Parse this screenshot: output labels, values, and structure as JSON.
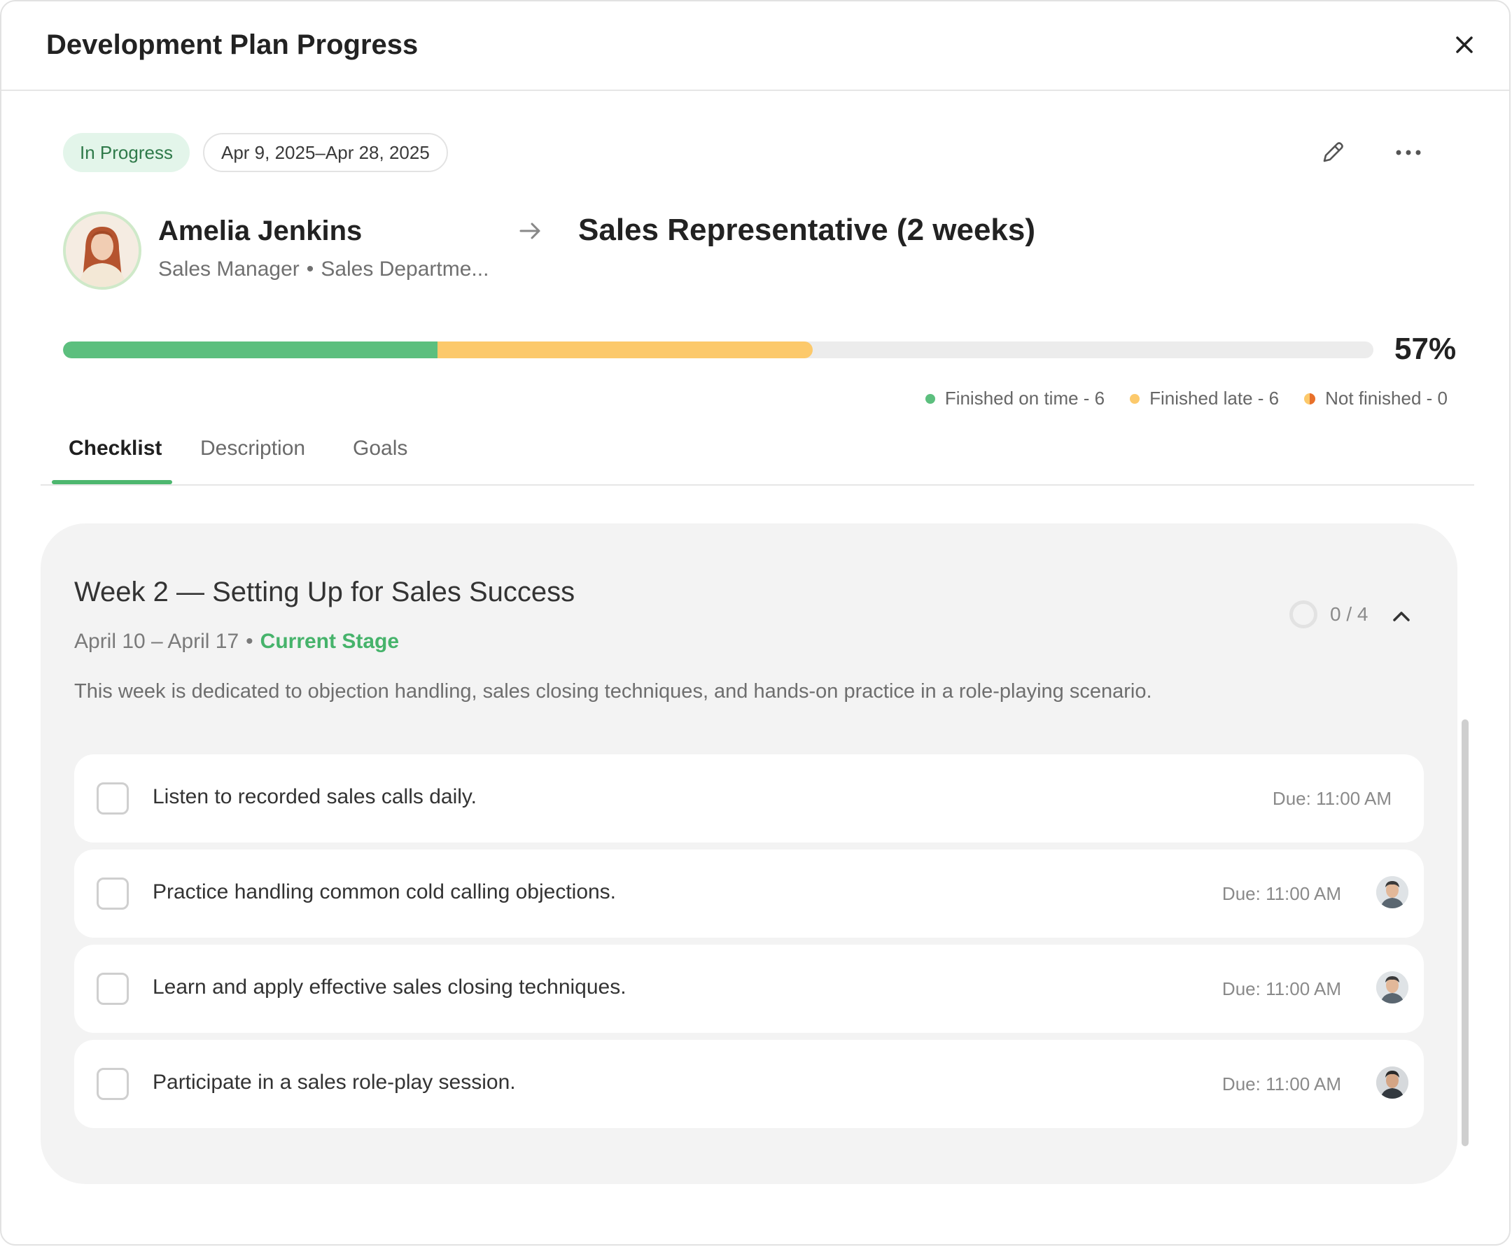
{
  "modal": {
    "title": "Development Plan Progress"
  },
  "plan": {
    "status": "In Progress",
    "date_range": "Apr 9, 2025–Apr 28, 2025",
    "person": {
      "name": "Amelia Jenkins",
      "position": "Sales Manager",
      "department": "Sales Departme..."
    },
    "target_role": "Sales Representative (2 weeks)",
    "progress": {
      "percent_label": "57%",
      "on_time_fraction": 0.286,
      "late_fraction": 0.286,
      "legend": [
        {
          "label": "Finished on time - 6",
          "color": "#5cbf7e"
        },
        {
          "label": "Finished late - 6",
          "color": "#fcc96b"
        },
        {
          "label": "Not finished - 0",
          "color": "#e8702a"
        }
      ]
    }
  },
  "tabs": [
    {
      "label": "Checklist",
      "active": true
    },
    {
      "label": "Description",
      "active": false
    },
    {
      "label": "Goals",
      "active": false
    }
  ],
  "stage": {
    "title": "Week 2 — Setting Up for Sales Success",
    "dates": "April 10 – April 17",
    "current_label": "Current Stage",
    "description": "This week is dedicated to objection handling, sales closing techniques, and hands-on practice in a role-playing scenario.",
    "counter": "0 / 4",
    "tasks": [
      {
        "label": "Listen to recorded sales calls daily.",
        "due": "Due: 11:00 AM",
        "has_assignee": false
      },
      {
        "label": "Practice handling common cold calling objections.",
        "due": "Due: 11:00 AM",
        "has_assignee": true
      },
      {
        "label": "Learn and apply effective sales closing techniques.",
        "due": "Due: 11:00 AM",
        "has_assignee": true
      },
      {
        "label": "Participate in a sales role-play session.",
        "due": "Due: 11:00 AM",
        "has_assignee": true
      }
    ]
  },
  "icons": {
    "close": "close-icon",
    "edit": "pencil-icon",
    "more": "more-horizontal-icon",
    "arrow": "arrow-right-icon",
    "collapse": "chevron-up-icon"
  },
  "colors": {
    "accent_green": "#4db76f",
    "on_time": "#5cbf7e",
    "late": "#fcc96b",
    "not_finished": "#e8702a",
    "status_bg": "#e3f5ea"
  }
}
